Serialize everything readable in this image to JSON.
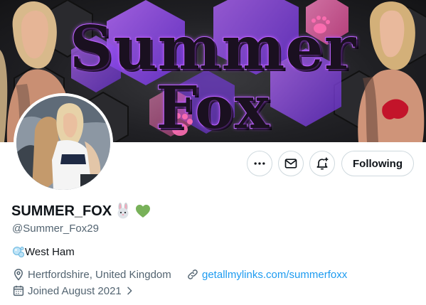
{
  "banner": {
    "title_line1": "Summer",
    "title_line2": "Fox"
  },
  "actions": {
    "more_icon": "more-horizontal-icon",
    "message_icon": "envelope-icon",
    "notify_icon": "bell-plus-icon",
    "following_label": "Following"
  },
  "profile": {
    "display_name": "SUMMER_FOX",
    "name_emojis": [
      "rabbit-emoji",
      "green-heart-emoji"
    ],
    "handle": "@Summer_Fox29",
    "bio": "West Ham",
    "bio_emoji": "bubbles-emoji",
    "location": "Hertfordshire, United Kingdom",
    "website": "getallmylinks.com/summerfoxx",
    "joined": "Joined August 2021"
  },
  "colors": {
    "link": "#1d9bf0",
    "secondary_text": "#536471",
    "border": "#cfd9de",
    "banner_purple": "#a855f7",
    "banner_pink": "#f472b6",
    "green_heart": "#78b159"
  }
}
